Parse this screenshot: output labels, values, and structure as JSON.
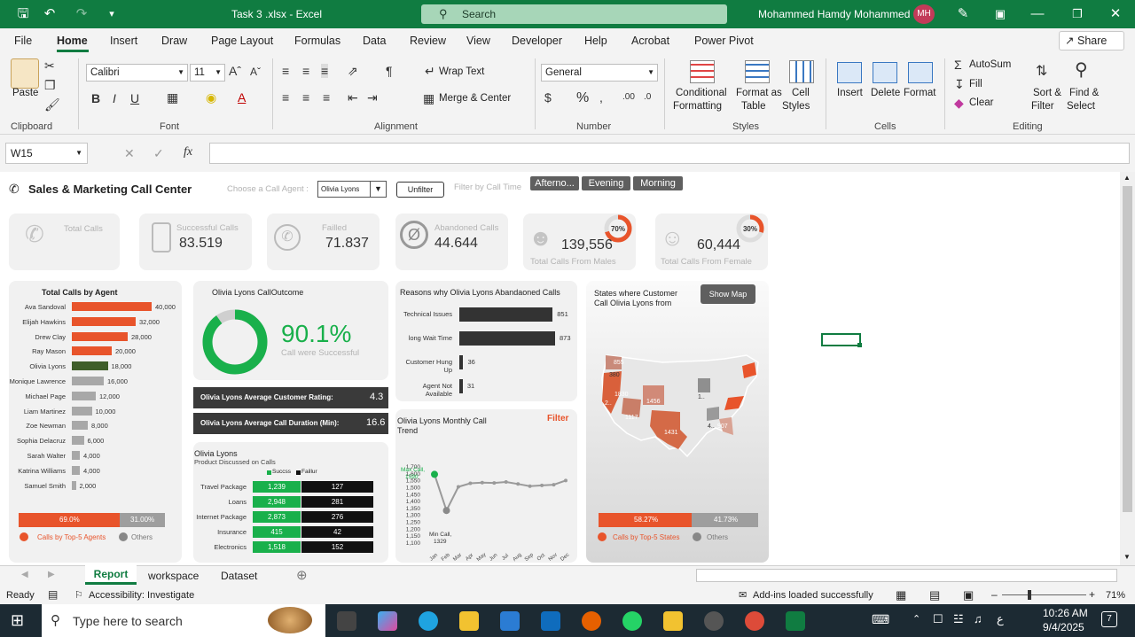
{
  "window": {
    "title": "Task 3 .xlsx  -  Excel",
    "search_placeholder": "Search",
    "user_name": "Mohammed Hamdy Mohammed",
    "user_initials": "MH"
  },
  "menu": [
    "File",
    "Home",
    "Insert",
    "Draw",
    "Page Layout",
    "Formulas",
    "Data",
    "Review",
    "View",
    "Developer",
    "Help",
    "Acrobat",
    "Power Pivot"
  ],
  "share_label": "Share",
  "ribbon": {
    "paste": "Paste",
    "font_name": "Calibri",
    "font_size": "11",
    "wrap_text": "Wrap Text",
    "merge_center": "Merge & Center",
    "number_format": "General",
    "conditional_1": "Conditional",
    "conditional_2": "Formatting",
    "format_table_1": "Format as",
    "format_table_2": "Table",
    "cell_styles_1": "Cell",
    "cell_styles_2": "Styles",
    "insert": "Insert",
    "delete": "Delete",
    "format": "Format",
    "autosum": "AutoSum",
    "fill": "Fill",
    "clear": "Clear",
    "sort_1": "Sort &",
    "sort_2": "Filter",
    "find_1": "Find &",
    "find_2": "Select",
    "groups": {
      "clipboard": "Clipboard",
      "font": "Font",
      "alignment": "Alignment",
      "number": "Number",
      "styles": "Styles",
      "cells": "Cells",
      "editing": "Editing"
    }
  },
  "name_box": "W15",
  "fx": "fx",
  "dashboard": {
    "title": "Sales & Marketing Call Center",
    "choose_agent_label": "Choose a Call Agent :",
    "agent_selected": "Olivia Lyons",
    "unfilter": "Unfilter",
    "filter_time_label": "Filter by Call Time",
    "time_buttons": [
      "Afterno...",
      "Evening",
      "Morning"
    ],
    "kpis": {
      "total_calls_label": "Total Calls",
      "successful_label": "Successful Calls",
      "successful_value": "83.519",
      "failed_label": "Failled",
      "failed_value": "71.837",
      "abandoned_label": "Abandoned Calls",
      "abandoned_value": "44.644",
      "males_value": "139,556",
      "males_label": "Total Calls From Males",
      "males_pct": "70%",
      "males_frac": 0.7,
      "females_value": "60,444",
      "females_label": "Total Calls From Female",
      "females_pct": "30%",
      "females_frac": 0.3
    },
    "agents_chart": {
      "title": "Total Calls by Agent",
      "agents": [
        {
          "name": "Ava Sandoval",
          "value": 40000,
          "label": "40,000",
          "tier": "top"
        },
        {
          "name": "Elijah Hawkins",
          "value": 32000,
          "label": "32,000",
          "tier": "top"
        },
        {
          "name": "Drew Clay",
          "value": 28000,
          "label": "28,000",
          "tier": "top"
        },
        {
          "name": "Ray Mason",
          "value": 20000,
          "label": "20,000",
          "tier": "top"
        },
        {
          "name": "Olivia Lyons",
          "value": 18000,
          "label": "18,000",
          "tier": "selected"
        },
        {
          "name": "Monique Lawrence",
          "value": 16000,
          "label": "16,000",
          "tier": "other"
        },
        {
          "name": "Michael Page",
          "value": 12000,
          "label": "12,000",
          "tier": "other"
        },
        {
          "name": "Liam Martinez",
          "value": 10000,
          "label": "10,000",
          "tier": "other"
        },
        {
          "name": "Zoe Newman",
          "value": 8000,
          "label": "8,000",
          "tier": "other"
        },
        {
          "name": "Sophia Delacruz",
          "value": 6000,
          "label": "6,000",
          "tier": "other"
        },
        {
          "name": "Sarah Walter",
          "value": 4000,
          "label": "4,000",
          "tier": "other"
        },
        {
          "name": "Katrina Williams",
          "value": 4000,
          "label": "4,000",
          "tier": "other"
        },
        {
          "name": "Samuel Smith",
          "value": 2000,
          "label": "2,000",
          "tier": "other"
        }
      ],
      "split_top": "69.0%",
      "split_top_frac": 0.69,
      "split_others": "31.00%",
      "legend_top": "Calls by Top-5 Agents",
      "legend_others": "Others"
    },
    "outcome": {
      "title": "Olivia Lyons CallOutcome",
      "pct": "90.1%",
      "frac": 0.901,
      "sub": "Call were Successful",
      "rating_label": "Olivia Lyons Average Customer Rating:",
      "rating_value": "4.3",
      "duration_label": "Olivia Lyons Average Call Duration (Min):",
      "duration_value": "16.6"
    },
    "products": {
      "title_1": "Olivia Lyons",
      "title_2": "Product Discussed on Calls",
      "legend_success": "Succss",
      "legend_fail": "Faillur",
      "rows": [
        {
          "name": "Travel Package",
          "success": "1,239",
          "fail": "127"
        },
        {
          "name": "Loans",
          "success": "2,948",
          "fail": "281"
        },
        {
          "name": "Internet Package",
          "success": "2,873",
          "fail": "276"
        },
        {
          "name": "Insurance",
          "success": "415",
          "fail": "42"
        },
        {
          "name": "Electronics",
          "success": "1,518",
          "fail": "152"
        }
      ]
    },
    "reasons": {
      "title": "Reasons why Olivia Lyons Abandaoned Calls",
      "items": [
        {
          "name": "Technical Issues",
          "value": 851
        },
        {
          "name": "long Wait Time",
          "value": 873
        },
        {
          "name": "Customer Hung Up",
          "value": 36
        },
        {
          "name": "Agent Not Available",
          "value": 31
        }
      ]
    },
    "trend": {
      "title_1": "Olivia Lyons Monthly Call",
      "title_2": "Trend",
      "filter": "Filter",
      "yticks": [
        "1,700",
        "1,600",
        "1,550",
        "1,500",
        "1,450",
        "1,400",
        "1,350",
        "1,300",
        "1,250",
        "1,200",
        "1,150",
        "1,100"
      ],
      "max_label_1": "Max Call,",
      "max_label_2": "1590",
      "min_label_1": "Min Call,",
      "min_label_2": "1329",
      "months": [
        "Jan",
        "Feb",
        "Mar",
        "Apr",
        "May",
        "Jun",
        "Jul",
        "Aug",
        "Sep",
        "Oct",
        "Nov",
        "Dec"
      ],
      "values": [
        1590,
        1329,
        1500,
        1525,
        1530,
        1528,
        1535,
        1520,
        1505,
        1510,
        1515,
        1545
      ]
    },
    "states": {
      "title_1": "States where Customer",
      "title_2": "Call Olivia Lyons from",
      "show_map": "Show Map",
      "labels": [
        "855",
        "380",
        "1830",
        "2..",
        "1117",
        "1456",
        "1431",
        "1..",
        "4..",
        "907"
      ],
      "split_top": "58.27%",
      "split_top_frac": 0.5827,
      "split_others": "41.73%",
      "legend_top": "Calls by Top-5 States",
      "legend_others": "Others"
    }
  },
  "sheet_tabs": [
    "Report",
    "workspace",
    "Dataset"
  ],
  "status": {
    "ready": "Ready",
    "accessibility": "Accessibility: Investigate",
    "addins": "Add-ins loaded successfully",
    "zoom": "71%"
  },
  "taskbar": {
    "search_placeholder": "Type here to search",
    "time": "10:26 AM",
    "date": "9/4/2025",
    "lang": "ع",
    "notif": "7"
  }
}
